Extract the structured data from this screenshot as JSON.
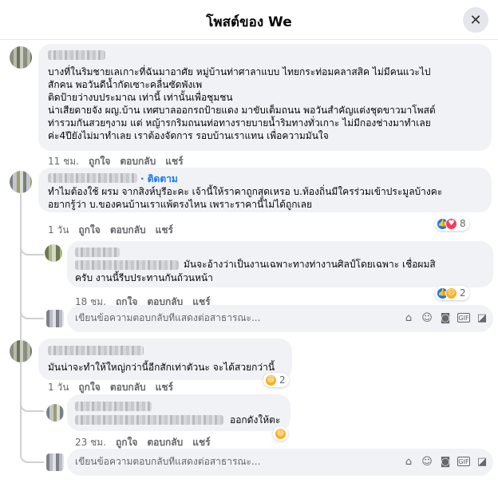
{
  "header": {
    "title": "โพสต์ของ We",
    "close_icon": "close-icon"
  },
  "comments": [
    {
      "text": "บางที่ในริมชายเลเกาะที่ฉันมาอาศัย หมู่บ้านท่าศาลาแบบ ไทยกระท่อมคลาสสิค ไม่มีคนแวะไป\nสักคน พอวันดีน้ำกัดเซาะคลื่นซัดพังเพ\nติดป้ายว่างบประมาณ เท่านี้ เท่านั้นเพื่อชุมชน\nน่าเสียดายจัง ผญ.บ้าน เทศบาลออกรถป้ายแดง มาขับเต็มถนน พอวันสำคัญแต่งชุดขาวมาโพสต์\nท่ารวมกันสวยๆงาม แต่ หญ้ารกริมถนนท่อทางรายบายน้ำริมทางทั่วเกาะ ไม่มีกองช่างมาทำเลย\nค่ะ4ปียังไม่มาทำเลย เราต้องจัดการ รอบบ้านเราแทน เพื่อความมันใจ",
      "time": "11 ชม.",
      "like": "ถูกใจ",
      "reply": "ตอบกลับ",
      "share": "แชร์"
    },
    {
      "follow": "· ติดตาม",
      "text": "ทำไมต้องใช้ ผรม จากสิงห์บุรีอะคะ เจ้านี้ให้ราคาถูกสุดเหรอ บ.ท้องถิ่นมีใครร่วมเข้าประมูลบ้างคะ\nอยากรู้ว่า บ.ของคนบ้านเราแพ้ตรงไหน เพราะราคานี้ไม่ได้ถูกเลย",
      "time": "1 วัน",
      "like": "ถูกใจ",
      "reply": "ตอบกลับ",
      "share": "แชร์",
      "reaction_count": "8",
      "replies": [
        {
          "text_line1": "มันจะอ้างว่าเป็นงานเฉพาะทางท่างานศิลป์โดยเฉพาะ เชื่อผมสิ",
          "text_line2": "ครับ งานนี้รีบประทานกันถ้วนหน้า",
          "time": "18 ชม.",
          "like": "ถูกใจ",
          "reply": "ตอบกลับ",
          "share": "แชร์",
          "reaction_count": "2"
        }
      ],
      "reply_placeholder": "เขียนข้อความตอบกลับที่แสดงต่อสาธารณะ..."
    },
    {
      "text": "มันน่าจะทำให้ใหญ่กว่านี้อีกสักเท่าตัวนะ จะได้สวยกว่านี้",
      "time": "1 วัน",
      "like": "ถูกใจ",
      "reply": "ตอบกลับ",
      "share": "แชร์",
      "reaction_count": "2",
      "replies": [
        {
          "text": "ออกดังให้ตะ",
          "time": "23 ชม.",
          "like": "ถูกใจ",
          "reply": "ตอบกลับ",
          "share": "แชร์"
        }
      ],
      "reply_placeholder": "เขียนข้อความตอบกลับที่แสดงต่อสาธารณะ..."
    }
  ],
  "composer_icons": [
    "sticker-icon",
    "emoji-icon",
    "camera-icon",
    "gif-icon",
    "sticker-alt-icon"
  ],
  "colors": {
    "link": "#1877f2",
    "bubble": "#f0f2f5",
    "muted": "#65676b"
  }
}
